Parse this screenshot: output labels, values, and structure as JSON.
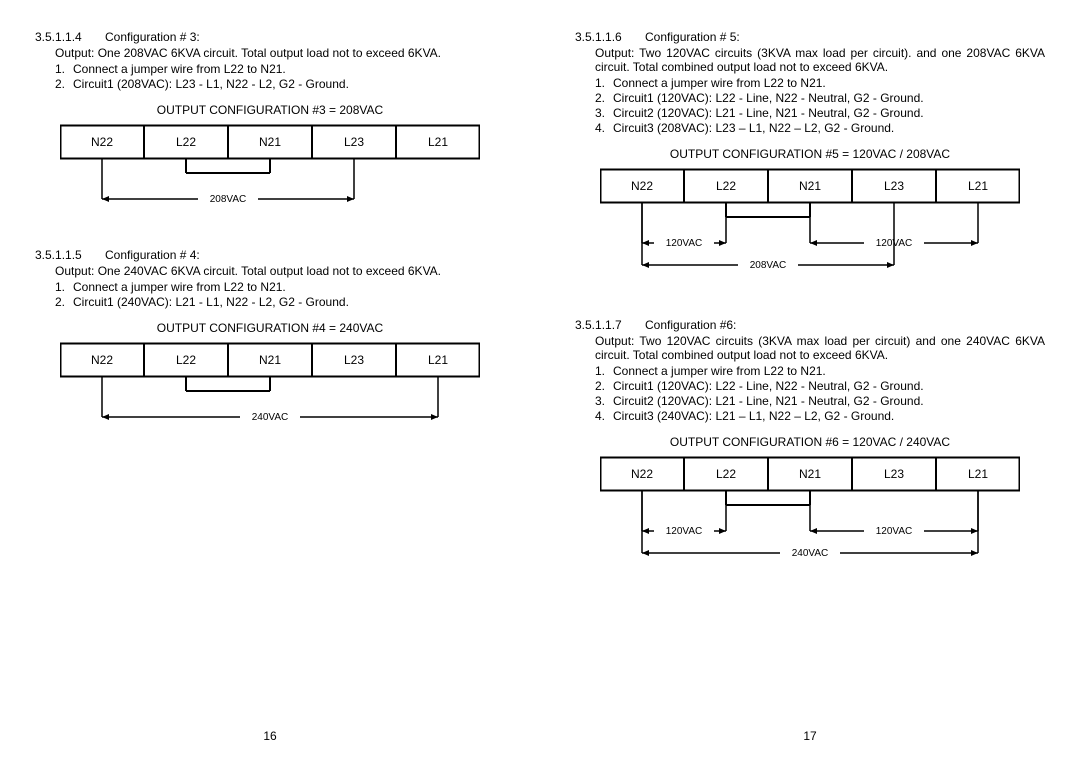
{
  "left": {
    "pageNumber": "16",
    "sections": [
      {
        "num": "3.5.1.1.4",
        "title": "Configuration # 3:",
        "output": "Output: One 208VAC 6KVA circuit. Total output load not to exceed 6KVA.",
        "steps": [
          "Connect a jumper wire from L22 to N21.",
          "Circuit1 (208VAC):   L23 - L1, N22 - L2, G2 - Ground."
        ],
        "diagram": {
          "title": "OUTPUT CONFIGURATION #3 = 208VAC",
          "terminals": [
            "N22",
            "L22",
            "N21",
            "L23",
            "L21"
          ],
          "jumper": [
            1,
            2
          ],
          "spans": [
            {
              "from": 0,
              "to": 3,
              "label": "208VAC"
            }
          ]
        }
      },
      {
        "num": "3.5.1.1.5",
        "title": "Configuration # 4:",
        "output": "Output: One 240VAC 6KVA circuit. Total output load not to exceed 6KVA.",
        "steps": [
          "Connect a jumper wire from L22 to N21.",
          "Circuit1 (240VAC):   L21 - L1, N22 - L2, G2 - Ground."
        ],
        "diagram": {
          "title": "OUTPUT CONFIGURATION #4 = 240VAC",
          "terminals": [
            "N22",
            "L22",
            "N21",
            "L23",
            "L21"
          ],
          "jumper": [
            1,
            2
          ],
          "spans": [
            {
              "from": 0,
              "to": 4,
              "label": "240VAC"
            }
          ]
        }
      }
    ]
  },
  "right": {
    "pageNumber": "17",
    "sections": [
      {
        "num": "3.5.1.1.6",
        "title": "Configuration # 5:",
        "output": "Output: Two 120VAC circuits (3KVA max load per circuit). and one 208VAC 6KVA circuit. Total combined output load not to exceed 6KVA.",
        "steps": [
          "Connect a jumper wire from L22 to N21.",
          "Circuit1 (120VAC):   L22 - Line, N22 - Neutral, G2 - Ground.",
          "Circuit2 (120VAC):   L21 - Line, N21 - Neutral, G2 - Ground.",
          "Circuit3 (208VAC):   L23 – L1, N22 – L2, G2 - Ground."
        ],
        "diagram": {
          "title": "OUTPUT CONFIGURATION #5 = 120VAC / 208VAC",
          "terminals": [
            "N22",
            "L22",
            "N21",
            "L23",
            "L21"
          ],
          "jumper": [
            1,
            2
          ],
          "spans": [
            {
              "from": 0,
              "to": 1,
              "label": "120VAC",
              "level": 1
            },
            {
              "from": 2,
              "to": 4,
              "label": "120VAC",
              "level": 1
            },
            {
              "from": 0,
              "to": 3,
              "label": "208VAC",
              "level": 2
            }
          ]
        }
      },
      {
        "num": "3.5.1.1.7",
        "title": "Configuration #6:",
        "output": "Output: Two 120VAC circuits (3KVA max load per circuit) and one 240VAC 6KVA circuit. Total combined output load not to exceed 6KVA.",
        "steps": [
          "Connect a jumper wire from L22 to N21.",
          "Circuit1 (120VAC):   L22 - Line, N22 - Neutral, G2 - Ground.",
          "Circuit2 (120VAC):   L21 - Line, N21 - Neutral, G2 - Ground.",
          "Circuit3 (240VAC):   L21 – L1, N22 – L2, G2 - Ground."
        ],
        "diagram": {
          "title": "OUTPUT CONFIGURATION #6 = 120VAC / 240VAC",
          "terminals": [
            "N22",
            "L22",
            "N21",
            "L23",
            "L21"
          ],
          "jumper": [
            1,
            2
          ],
          "spans": [
            {
              "from": 0,
              "to": 1,
              "label": "120VAC",
              "level": 1
            },
            {
              "from": 2,
              "to": 4,
              "label": "120VAC",
              "level": 1
            },
            {
              "from": 0,
              "to": 4,
              "label": "240VAC",
              "level": 2
            }
          ]
        }
      }
    ]
  }
}
